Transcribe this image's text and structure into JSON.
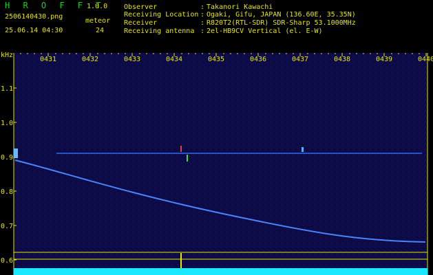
{
  "app": {
    "title": "H R O F F T",
    "version": "1.0.0"
  },
  "file": {
    "name": "2506140430.png",
    "datetime": "25.06.14 04:30"
  },
  "meteor": {
    "label": "meteor",
    "count": "24"
  },
  "info": [
    {
      "key": "Observer",
      "value": "Takanori Kawachi"
    },
    {
      "key": "Receiving Location",
      "value": "Ogaki, Gifu, JAPAN (136.60E, 35.35N)"
    },
    {
      "key": "Receiver",
      "value": "R820T2(RTL-SDR) SDR-Sharp 53.1000MHz"
    },
    {
      "key": "Receiving antenna",
      "value": "2el-HB9CV Vertical (el. E-W)"
    }
  ],
  "axis": {
    "unit": "kHz",
    "x_ticks": [
      "0431",
      "0432",
      "0433",
      "0434",
      "0435",
      "0436",
      "0437",
      "0438",
      "0439",
      "0440"
    ],
    "y_ticks": [
      "1.1",
      "1.0",
      "0.9",
      "0.8",
      "0.7",
      "0.6"
    ]
  },
  "colors": {
    "text": "#e8e800",
    "title": "#19d219",
    "background": "#000000",
    "trace": "#3c7cff",
    "level": "#19e8ff"
  }
}
